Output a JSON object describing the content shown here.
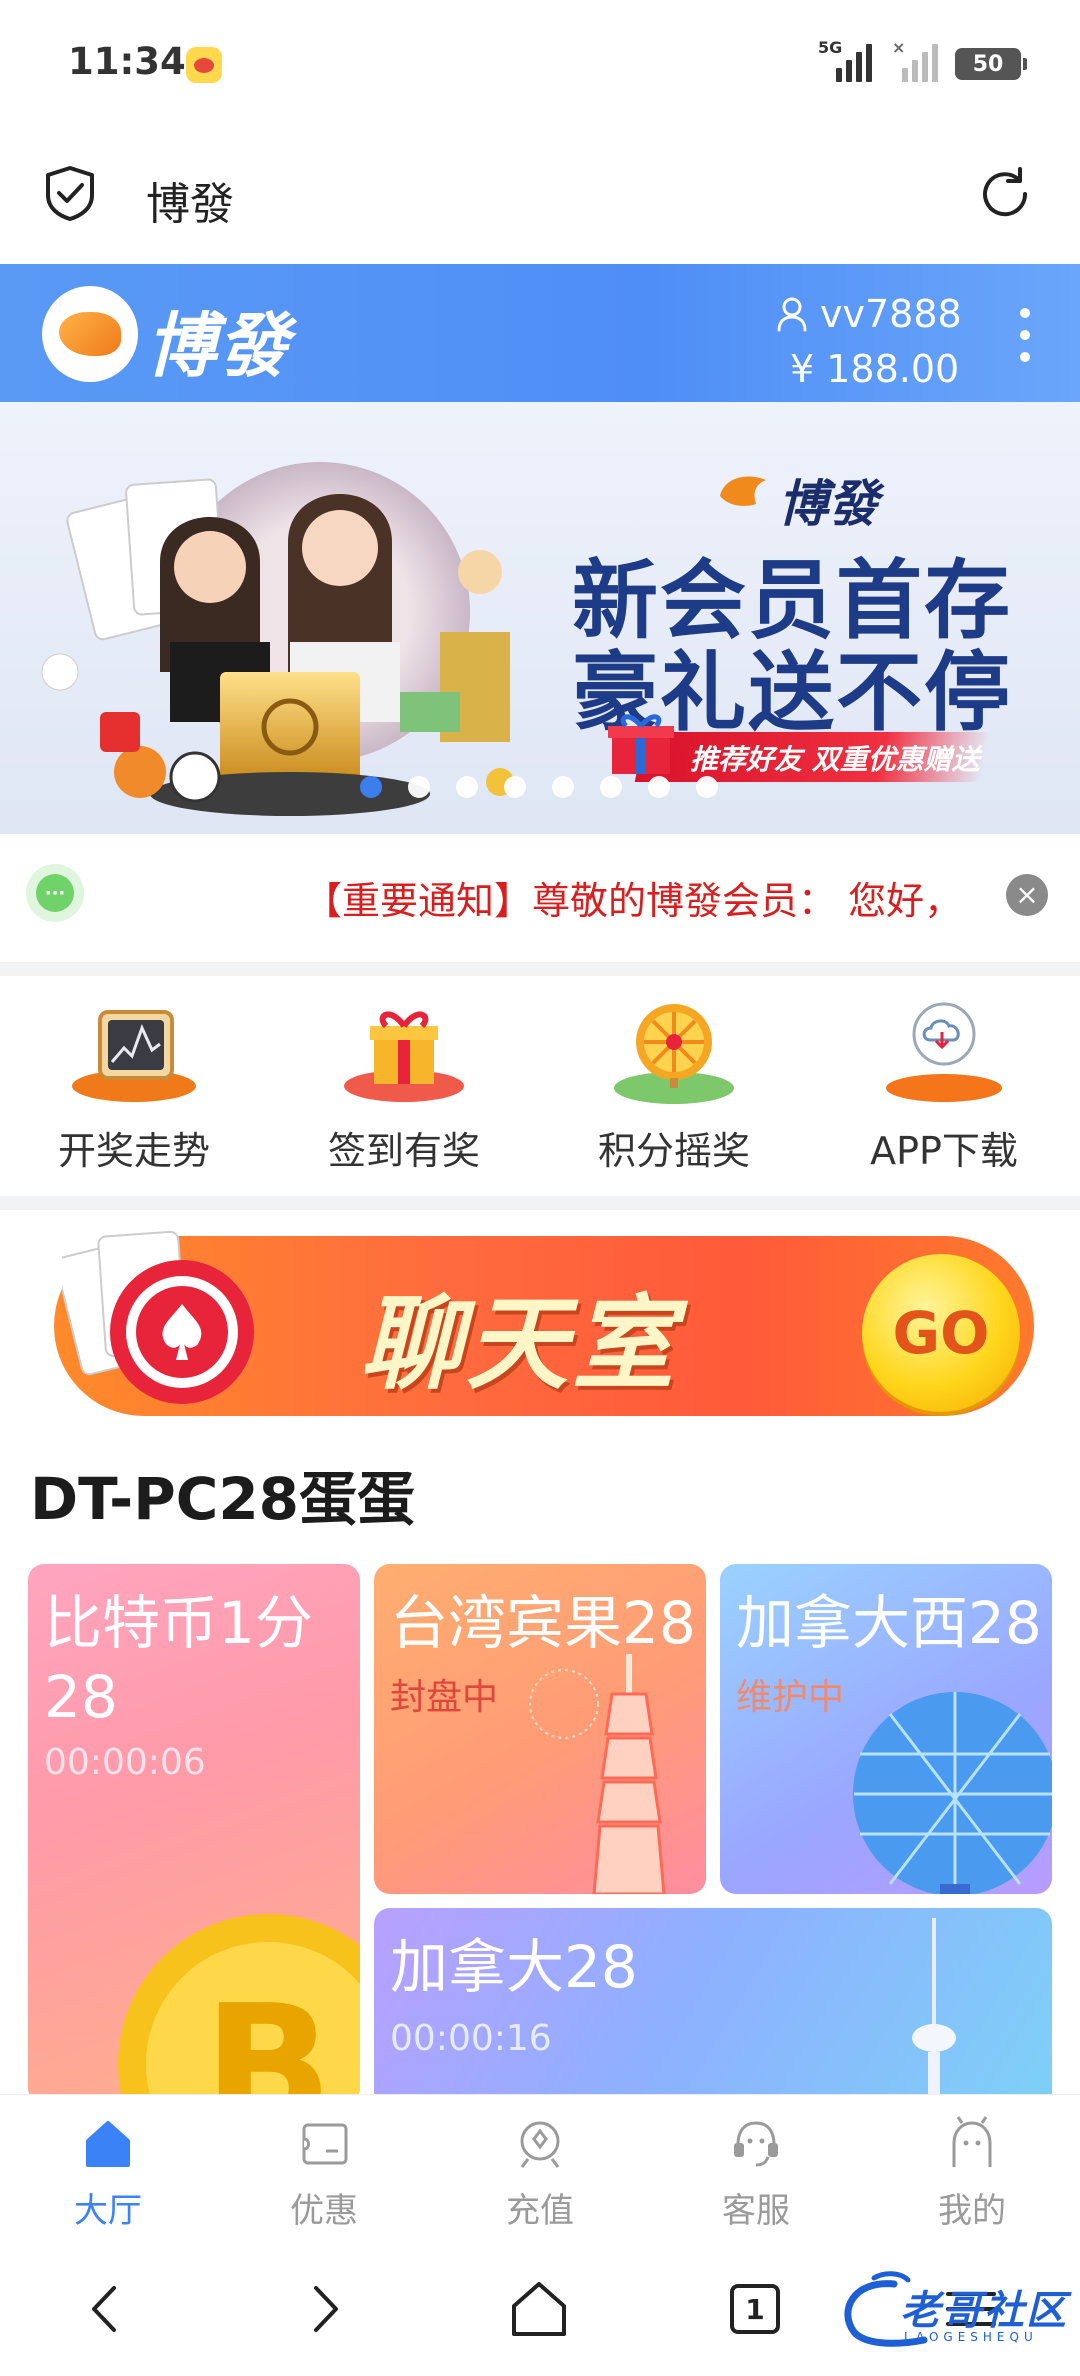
{
  "status_bar": {
    "time": "11:34",
    "signal_label": "5G",
    "battery": "50",
    "icons": [
      "weibo-icon",
      "signal-icon",
      "signal-no-service-icon",
      "battery-icon"
    ]
  },
  "browser": {
    "title": "博發",
    "icons": [
      "shield-check-icon",
      "refresh-icon"
    ]
  },
  "header": {
    "logo_text": "博發",
    "username": "vv7888",
    "balance": "¥ 188.00",
    "icons": [
      "user-icon",
      "more-vertical-icon"
    ]
  },
  "banner": {
    "brand": "博發",
    "line1": "新会员首存",
    "line2": "豪礼送不停",
    "ribbon": "推荐好友  双重优惠赠送",
    "slide_count": 8,
    "active_slide": 0
  },
  "notice": {
    "text": "【重要通知】尊敬的博發会员：  您好，",
    "icons": [
      "chat-bubble-icon",
      "close-icon"
    ]
  },
  "quick_menu": [
    {
      "label": "开奖走势",
      "icon": "trend-chart-icon"
    },
    {
      "label": "签到有奖",
      "icon": "gift-icon"
    },
    {
      "label": "积分摇奖",
      "icon": "prize-wheel-icon"
    },
    {
      "label": "APP下载",
      "icon": "cloud-download-icon"
    }
  ],
  "chat_banner": {
    "title": "聊天室",
    "go": "GO"
  },
  "section": {
    "title": "DT-PC28蛋蛋"
  },
  "games": [
    {
      "name_line1": "比特币1分",
      "name_line2": "28",
      "status": "00:00:06"
    },
    {
      "name_line1": "台湾宾果28",
      "status": "封盘中"
    },
    {
      "name_line1": "加拿大西28",
      "status": "维护中"
    },
    {
      "name_line1": "加拿大28",
      "status": "00:00:16"
    }
  ],
  "tabs": [
    {
      "label": "大厅",
      "icon": "home-icon",
      "active": true
    },
    {
      "label": "优惠",
      "icon": "coupon-icon",
      "active": false
    },
    {
      "label": "充值",
      "icon": "recharge-icon",
      "active": false
    },
    {
      "label": "客服",
      "icon": "customer-service-icon",
      "active": false
    },
    {
      "label": "我的",
      "icon": "profile-icon",
      "active": false
    }
  ],
  "system_nav": {
    "tab_count": "1",
    "icons": [
      "back-icon",
      "forward-icon",
      "home-outline-icon",
      "tabs-icon",
      "menu-icon"
    ]
  },
  "watermark": {
    "text": "老哥社区",
    "sub": "LAOGESHEQU"
  },
  "colors": {
    "primary": "#4f8ef6",
    "notice_red": "#d81e1e",
    "tab_active": "#3b82f6",
    "tab_inactive": "#9a9a9a",
    "status_orange": "#e0473a"
  }
}
